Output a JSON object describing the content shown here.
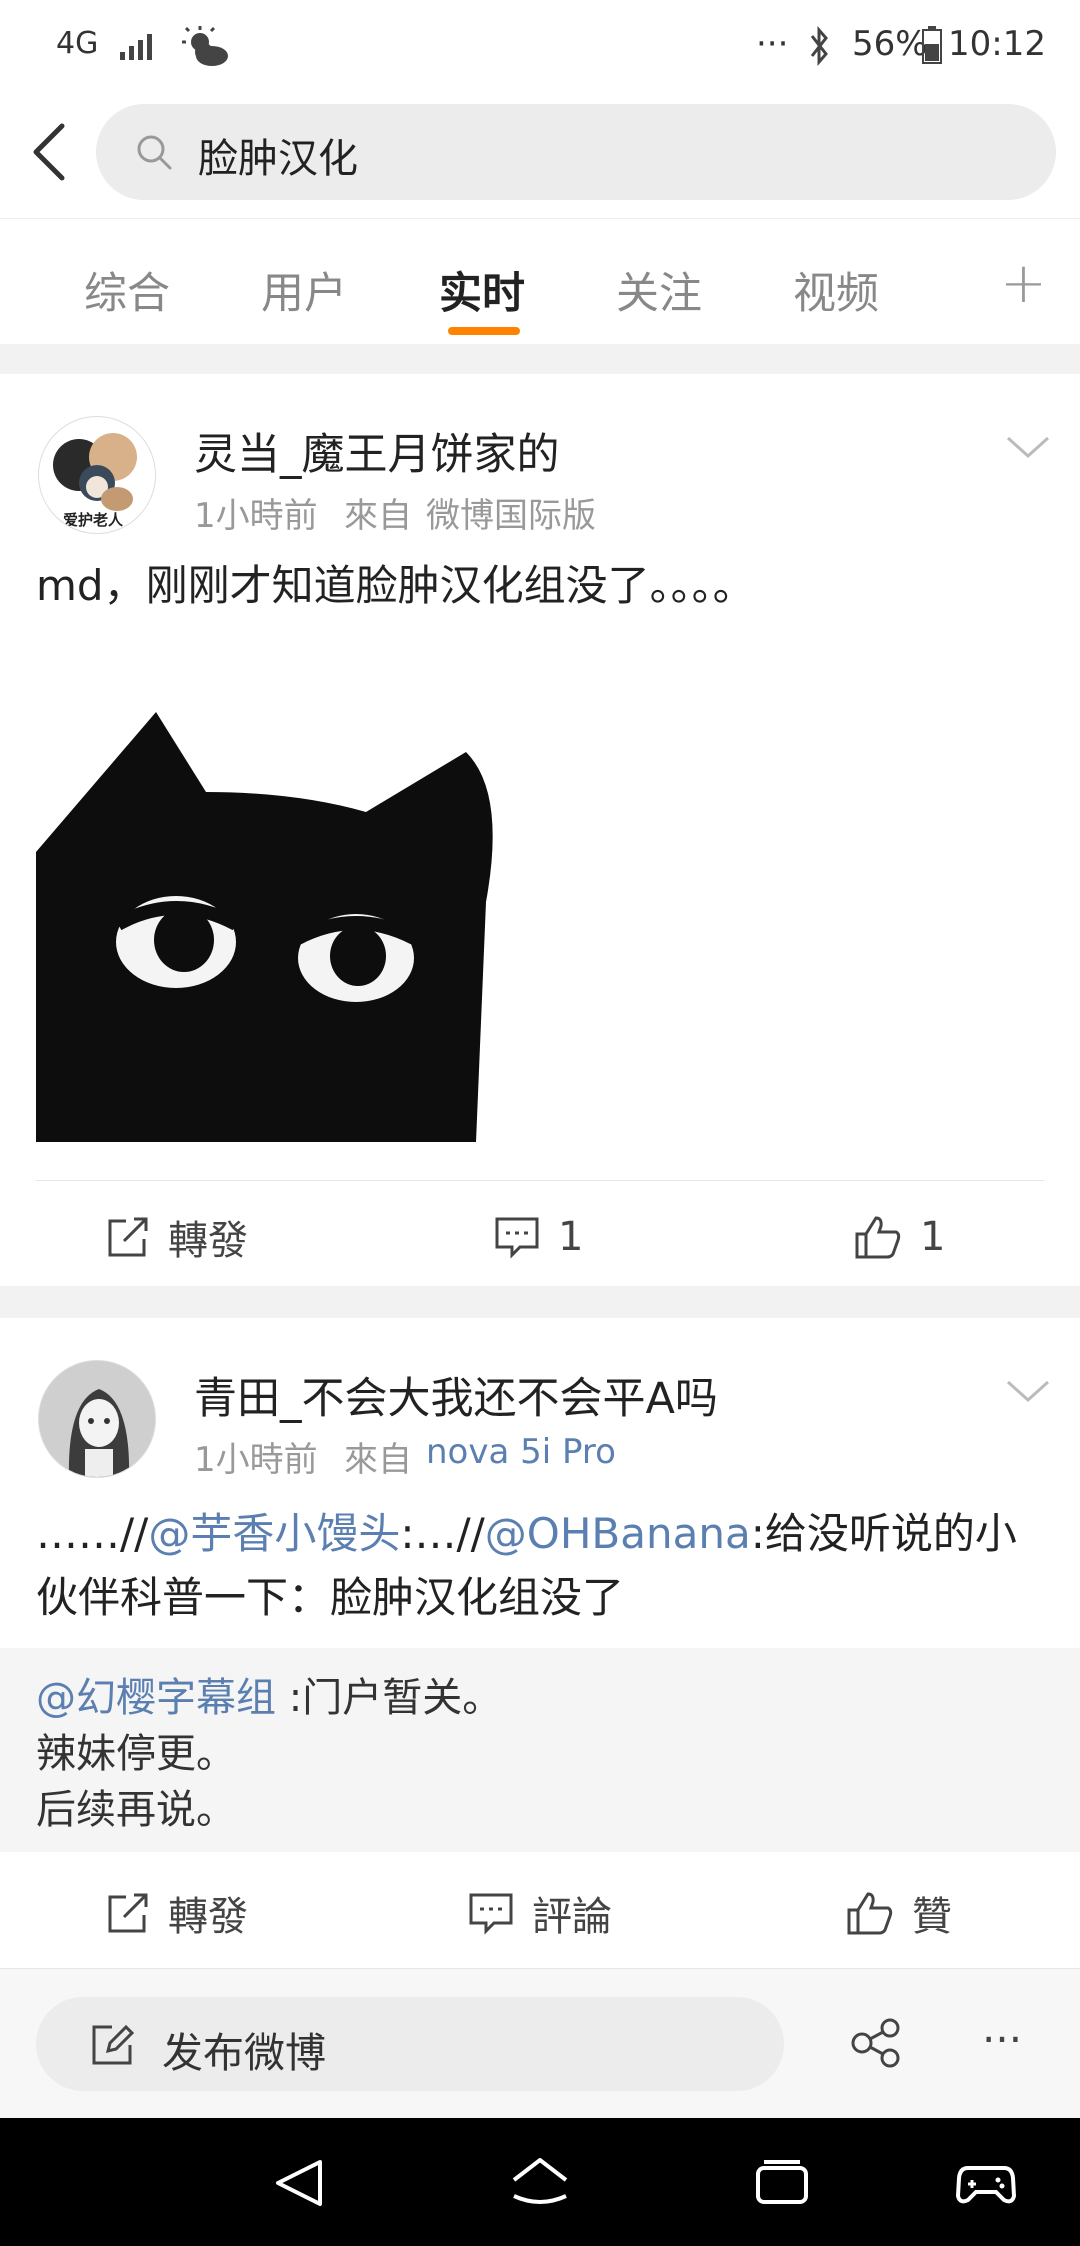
{
  "status_bar": {
    "network": "4G",
    "dots": "···",
    "battery": "56%",
    "time": "10:12"
  },
  "search": {
    "query": "脸肿汉化"
  },
  "tabs": [
    {
      "label": "综合"
    },
    {
      "label": "用户"
    },
    {
      "label": "实时",
      "active": true
    },
    {
      "label": "关注"
    },
    {
      "label": "视频"
    }
  ],
  "tab_plus": "+",
  "posts": [
    {
      "username": "灵当_魔王月饼家的",
      "time": "1小時前",
      "source_prefix": "來自",
      "source": "微博国际版",
      "avatar_caption": "爱护老人",
      "text": "md，刚刚才知道脸肿汉化组没了。。。。",
      "actions": {
        "repost": "轉發",
        "comment": "1",
        "like": "1"
      }
    },
    {
      "username": "青田_不会大我还不会平A吗",
      "time": "1小時前",
      "source_prefix": "來自",
      "source": "nova 5i Pro",
      "text_parts": {
        "p1": "……//",
        "mention1": "@芋香小馒头",
        "p2": ":…//",
        "mention2": "@OHBanana",
        "p3": ":给没听说的小",
        "line2": "伙伴科普一下：脸肿汉化组没了"
      },
      "quote": {
        "mention": "@幻樱字幕组",
        "line1_rest": " :门户暂关。",
        "line2": "辣妹停更。",
        "line3": "后续再说。"
      },
      "actions": {
        "repost": "轉發",
        "comment": "評論",
        "like": "贊"
      }
    }
  ],
  "bottom": {
    "compose": "发布微博",
    "more": "···"
  },
  "colors": {
    "accent": "#ff8200",
    "link": "#5b7fb0"
  }
}
